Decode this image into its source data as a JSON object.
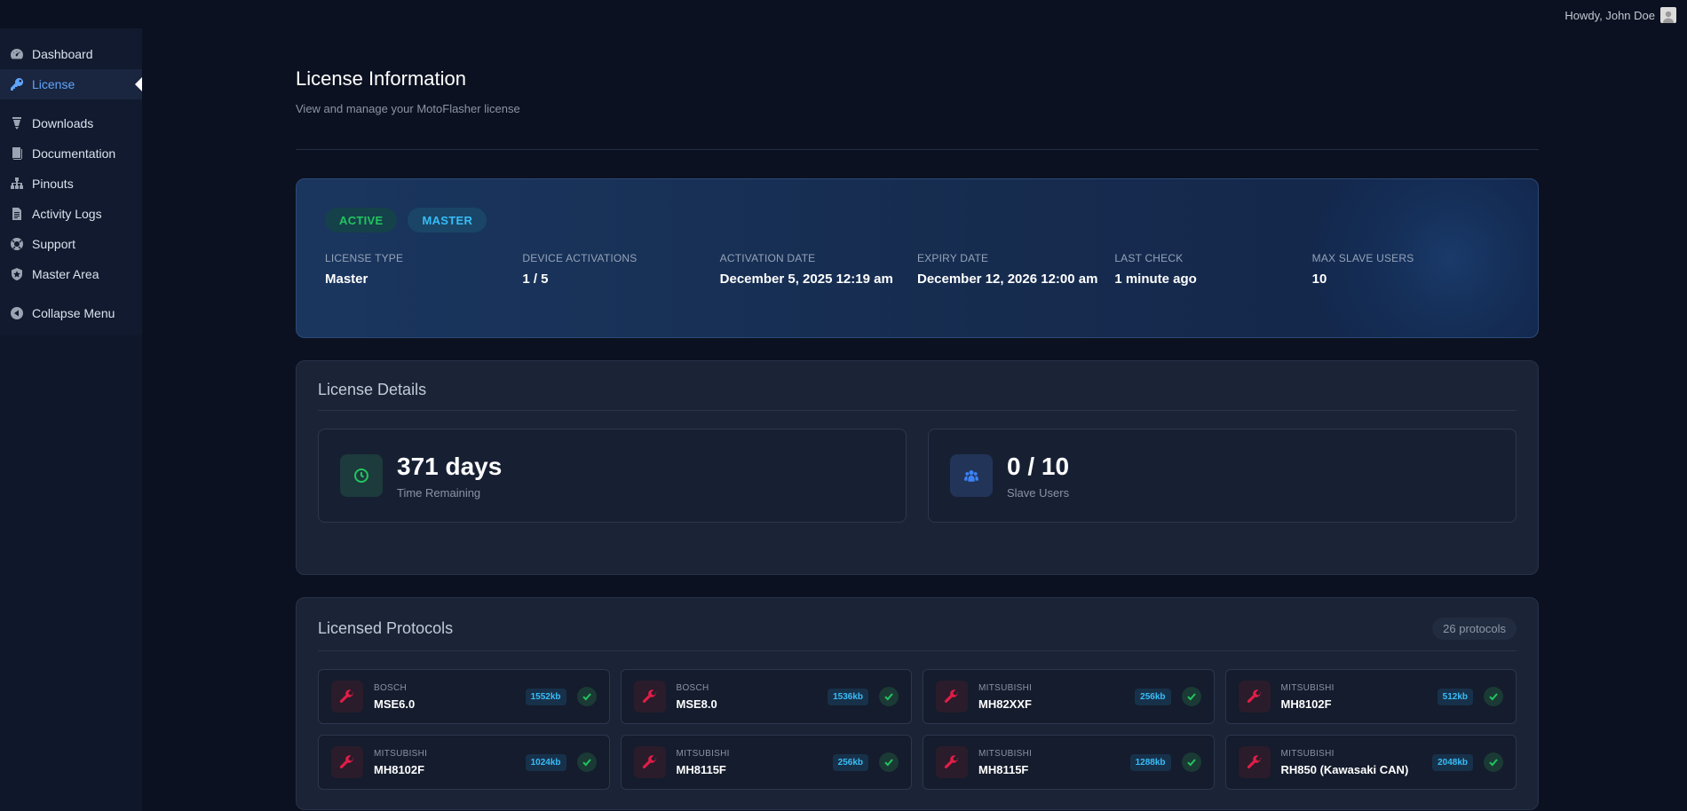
{
  "topbar": {
    "greeting": "Howdy, John Doe"
  },
  "sidebar": {
    "items": [
      {
        "label": "Dashboard",
        "icon": "dashboard-icon"
      },
      {
        "label": "License",
        "icon": "key-icon",
        "active": true
      },
      {
        "label": "Downloads",
        "icon": "download-icon"
      },
      {
        "label": "Documentation",
        "icon": "book-icon"
      },
      {
        "label": "Pinouts",
        "icon": "sitemap-icon"
      },
      {
        "label": "Activity Logs",
        "icon": "document-icon"
      },
      {
        "label": "Support",
        "icon": "lifebuoy-icon"
      },
      {
        "label": "Master Area",
        "icon": "shield-icon"
      },
      {
        "label": "Collapse Menu",
        "icon": "collapse-icon"
      }
    ]
  },
  "page": {
    "title": "License Information",
    "subtitle": "View and manage your MotoFlasher license"
  },
  "hero": {
    "badges": [
      "ACTIVE",
      "MASTER"
    ],
    "stats": [
      {
        "label": "LICENSE TYPE",
        "value": "Master"
      },
      {
        "label": "DEVICE ACTIVATIONS",
        "value": "1 / 5"
      },
      {
        "label": "ACTIVATION DATE",
        "value": "December 5, 2025 12:19 am"
      },
      {
        "label": "EXPIRY DATE",
        "value": "December 12, 2026 12:00 am"
      },
      {
        "label": "LAST CHECK",
        "value": "1 minute ago"
      },
      {
        "label": "MAX SLAVE USERS",
        "value": "10"
      }
    ]
  },
  "details": {
    "title": "License Details",
    "time": {
      "value": "371 days",
      "label": "Time Remaining"
    },
    "slaves": {
      "value": "0 / 10",
      "label": "Slave Users"
    }
  },
  "protocols": {
    "title": "Licensed Protocols",
    "count": "26 protocols",
    "items": [
      {
        "vendor": "BOSCH",
        "name": "MSE6.0",
        "size": "1552kb"
      },
      {
        "vendor": "BOSCH",
        "name": "MSE8.0",
        "size": "1536kb"
      },
      {
        "vendor": "MITSUBISHI",
        "name": "MH82XXF",
        "size": "256kb"
      },
      {
        "vendor": "MITSUBISHI",
        "name": "MH8102F",
        "size": "512kb"
      },
      {
        "vendor": "MITSUBISHI",
        "name": "MH8102F",
        "size": "1024kb"
      },
      {
        "vendor": "MITSUBISHI",
        "name": "MH8115F",
        "size": "256kb"
      },
      {
        "vendor": "MITSUBISHI",
        "name": "MH8115F",
        "size": "1288kb"
      },
      {
        "vendor": "MITSUBISHI",
        "name": "RH850 (Kawasaki CAN)",
        "size": "2048kb"
      }
    ]
  },
  "colors": {
    "accent": "#60a5fa",
    "success": "#22c55e",
    "info": "#38bdf8",
    "danger": "#e11d48"
  }
}
